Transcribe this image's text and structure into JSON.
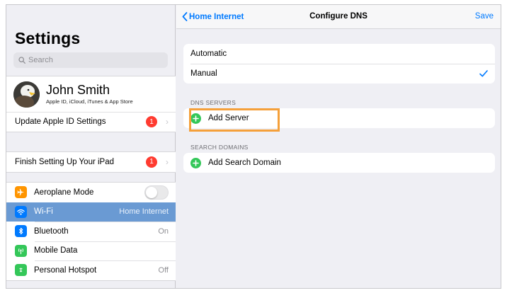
{
  "sidebar": {
    "title": "Settings",
    "search_placeholder": "Search",
    "profile": {
      "name": "John Smith",
      "subtitle": "Apple ID, iCloud, iTunes & App Store"
    },
    "update_apple_id": {
      "label": "Update Apple ID Settings",
      "badge": "1"
    },
    "finish_setup": {
      "label": "Finish Setting Up Your iPad",
      "badge": "1"
    },
    "connectivity": [
      {
        "name": "aeroplane-mode",
        "label": "Aeroplane Mode",
        "value": "",
        "icon": "airplane-icon",
        "color": "#ff9500",
        "toggle": "off"
      },
      {
        "name": "wifi",
        "label": "Wi-Fi",
        "value": "Home Internet",
        "icon": "wifi-icon",
        "color": "#007aff",
        "selected": true
      },
      {
        "name": "bluetooth",
        "label": "Bluetooth",
        "value": "On",
        "icon": "bluetooth-icon",
        "color": "#007aff"
      },
      {
        "name": "mobile-data",
        "label": "Mobile Data",
        "value": "",
        "icon": "antenna-icon",
        "color": "#34c759"
      },
      {
        "name": "personal-hotspot",
        "label": "Personal Hotspot",
        "value": "Off",
        "icon": "hotspot-icon",
        "color": "#34c759"
      }
    ]
  },
  "detail": {
    "back_label": "Home Internet",
    "title": "Configure DNS",
    "save_label": "Save",
    "mode_options": [
      {
        "label": "Automatic",
        "checked": false
      },
      {
        "label": "Manual",
        "checked": true
      }
    ],
    "dns_servers_header": "DNS SERVERS",
    "add_server_label": "Add Server",
    "search_domains_header": "SEARCH DOMAINS",
    "add_search_domain_label": "Add Search Domain"
  },
  "colors": {
    "accent": "#007aff",
    "selected_row": "#6a9ad3",
    "badge": "#ff3b30",
    "add_green": "#34c759",
    "highlight": "#f5a03a"
  }
}
